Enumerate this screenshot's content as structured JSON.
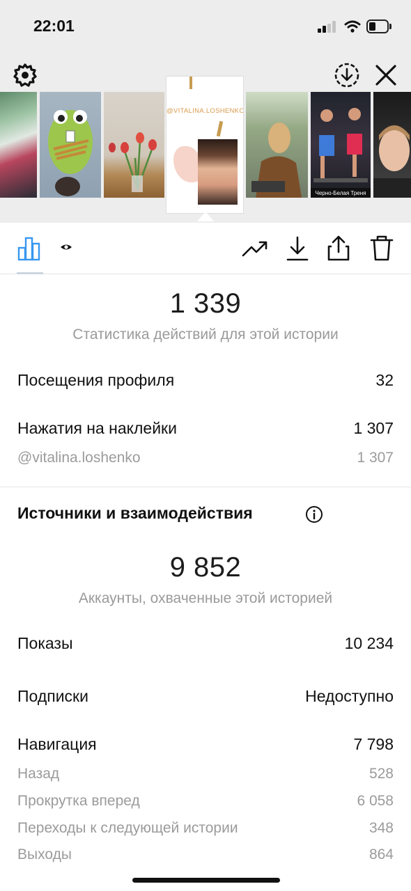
{
  "status_bar": {
    "time": "22:01"
  },
  "top_controls": {
    "settings_icon": "gear-icon",
    "download_icon": "download-circle-icon",
    "close_icon": "close-icon"
  },
  "thumbnails": {
    "selected_username": "@VITALINA.LOSHENKO"
  },
  "toolbar": {
    "insights_icon": "bar-chart-icon",
    "views_icon": "eye-icon",
    "promote_icon": "trending-up-icon",
    "save_icon": "download-icon",
    "share_icon": "share-icon",
    "delete_icon": "trash-icon"
  },
  "interactions": {
    "total": "1 339",
    "caption": "Статистика действий для этой истории",
    "rows": [
      {
        "label": "Посещения профиля",
        "value": "32"
      },
      {
        "label": "Нажатия на наклейки",
        "value": "1 307"
      }
    ],
    "sticker_sub": {
      "label": "@vitalina.loshenko",
      "value": "1 307"
    }
  },
  "discovery": {
    "title": "Источники и взаимодействия",
    "info_icon": "info-icon",
    "total": "9 852",
    "caption": "Аккаунты, охваченные этой историей",
    "impressions": {
      "label": "Показы",
      "value": "10 234"
    },
    "follows": {
      "label": "Подписки",
      "value": "Недоступно"
    },
    "navigation": {
      "label": "Навигация",
      "value": "7 798"
    },
    "navigation_breakdown": [
      {
        "label": "Назад",
        "value": "528"
      },
      {
        "label": "Прокрутка вперед",
        "value": "6 058"
      },
      {
        "label": "Переходы к следующей истории",
        "value": "348"
      },
      {
        "label": "Выходы",
        "value": "864"
      }
    ]
  },
  "colors": {
    "accent_blue": "#3897f0",
    "top_background": "#ededed",
    "muted_text": "#9b9b9b"
  }
}
